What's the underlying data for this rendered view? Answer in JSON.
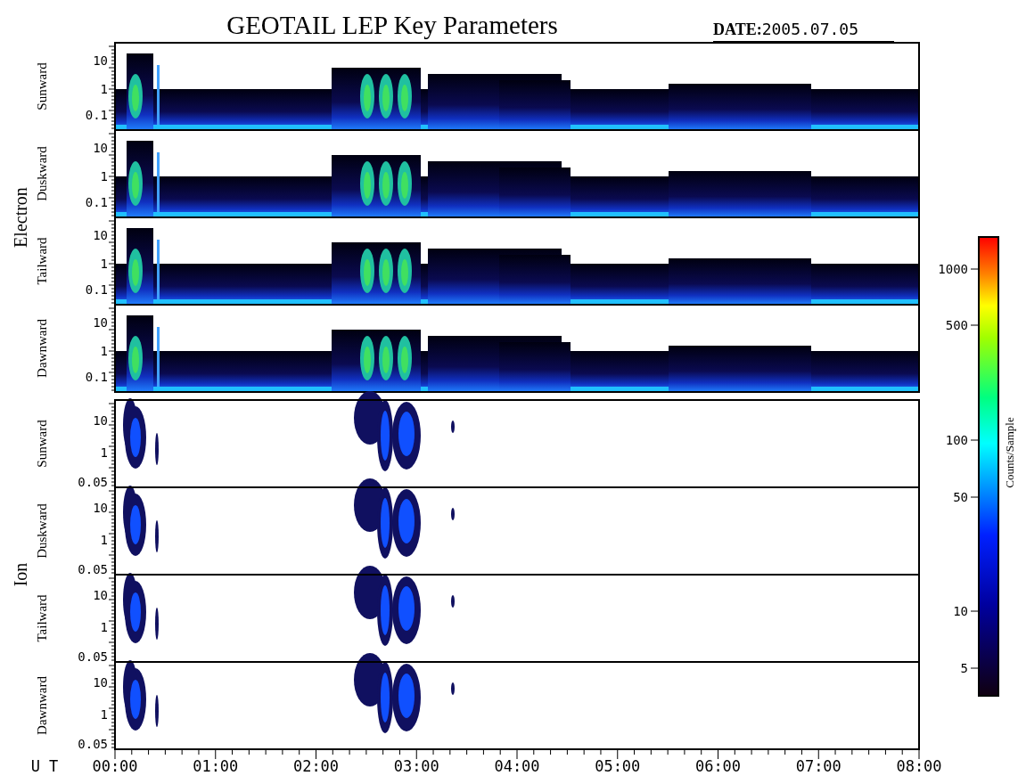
{
  "title": "GEOTAIL LEP Key Parameters",
  "date_label": "DATE:",
  "date": "2005.07.05",
  "groups": [
    {
      "name": "Electron",
      "kind": "electron",
      "panels": [
        {
          "label": "Sunward",
          "yticks": [
            "10",
            "1",
            "0.1"
          ]
        },
        {
          "label": "Duskward",
          "yticks": [
            "10",
            "1",
            "0.1"
          ]
        },
        {
          "label": "Tailward",
          "yticks": [
            "10",
            "1",
            "0.1"
          ]
        },
        {
          "label": "Dawnward",
          "yticks": [
            "10",
            "1",
            "0.1"
          ]
        }
      ]
    },
    {
      "name": "Ion",
      "kind": "ion",
      "panels": [
        {
          "label": "Sunward",
          "yticks": [
            "10",
            "1",
            "0.05"
          ]
        },
        {
          "label": "Duskward",
          "yticks": [
            "10",
            "1",
            "0.05"
          ]
        },
        {
          "label": "Tailward",
          "yticks": [
            "10",
            "1",
            "0.05"
          ]
        },
        {
          "label": "Dawnward",
          "yticks": [
            "10",
            "1",
            "0.05"
          ]
        }
      ]
    }
  ],
  "x_axis": {
    "label": "U T",
    "ticks": [
      "00:00",
      "01:00",
      "02:00",
      "03:00",
      "04:00",
      "05:00",
      "06:00",
      "07:00",
      "08:00"
    ]
  },
  "colorbar": {
    "label": "Counts/Sample",
    "ticks": [
      "1000",
      "500",
      "100",
      "50",
      "10",
      "5"
    ]
  }
}
